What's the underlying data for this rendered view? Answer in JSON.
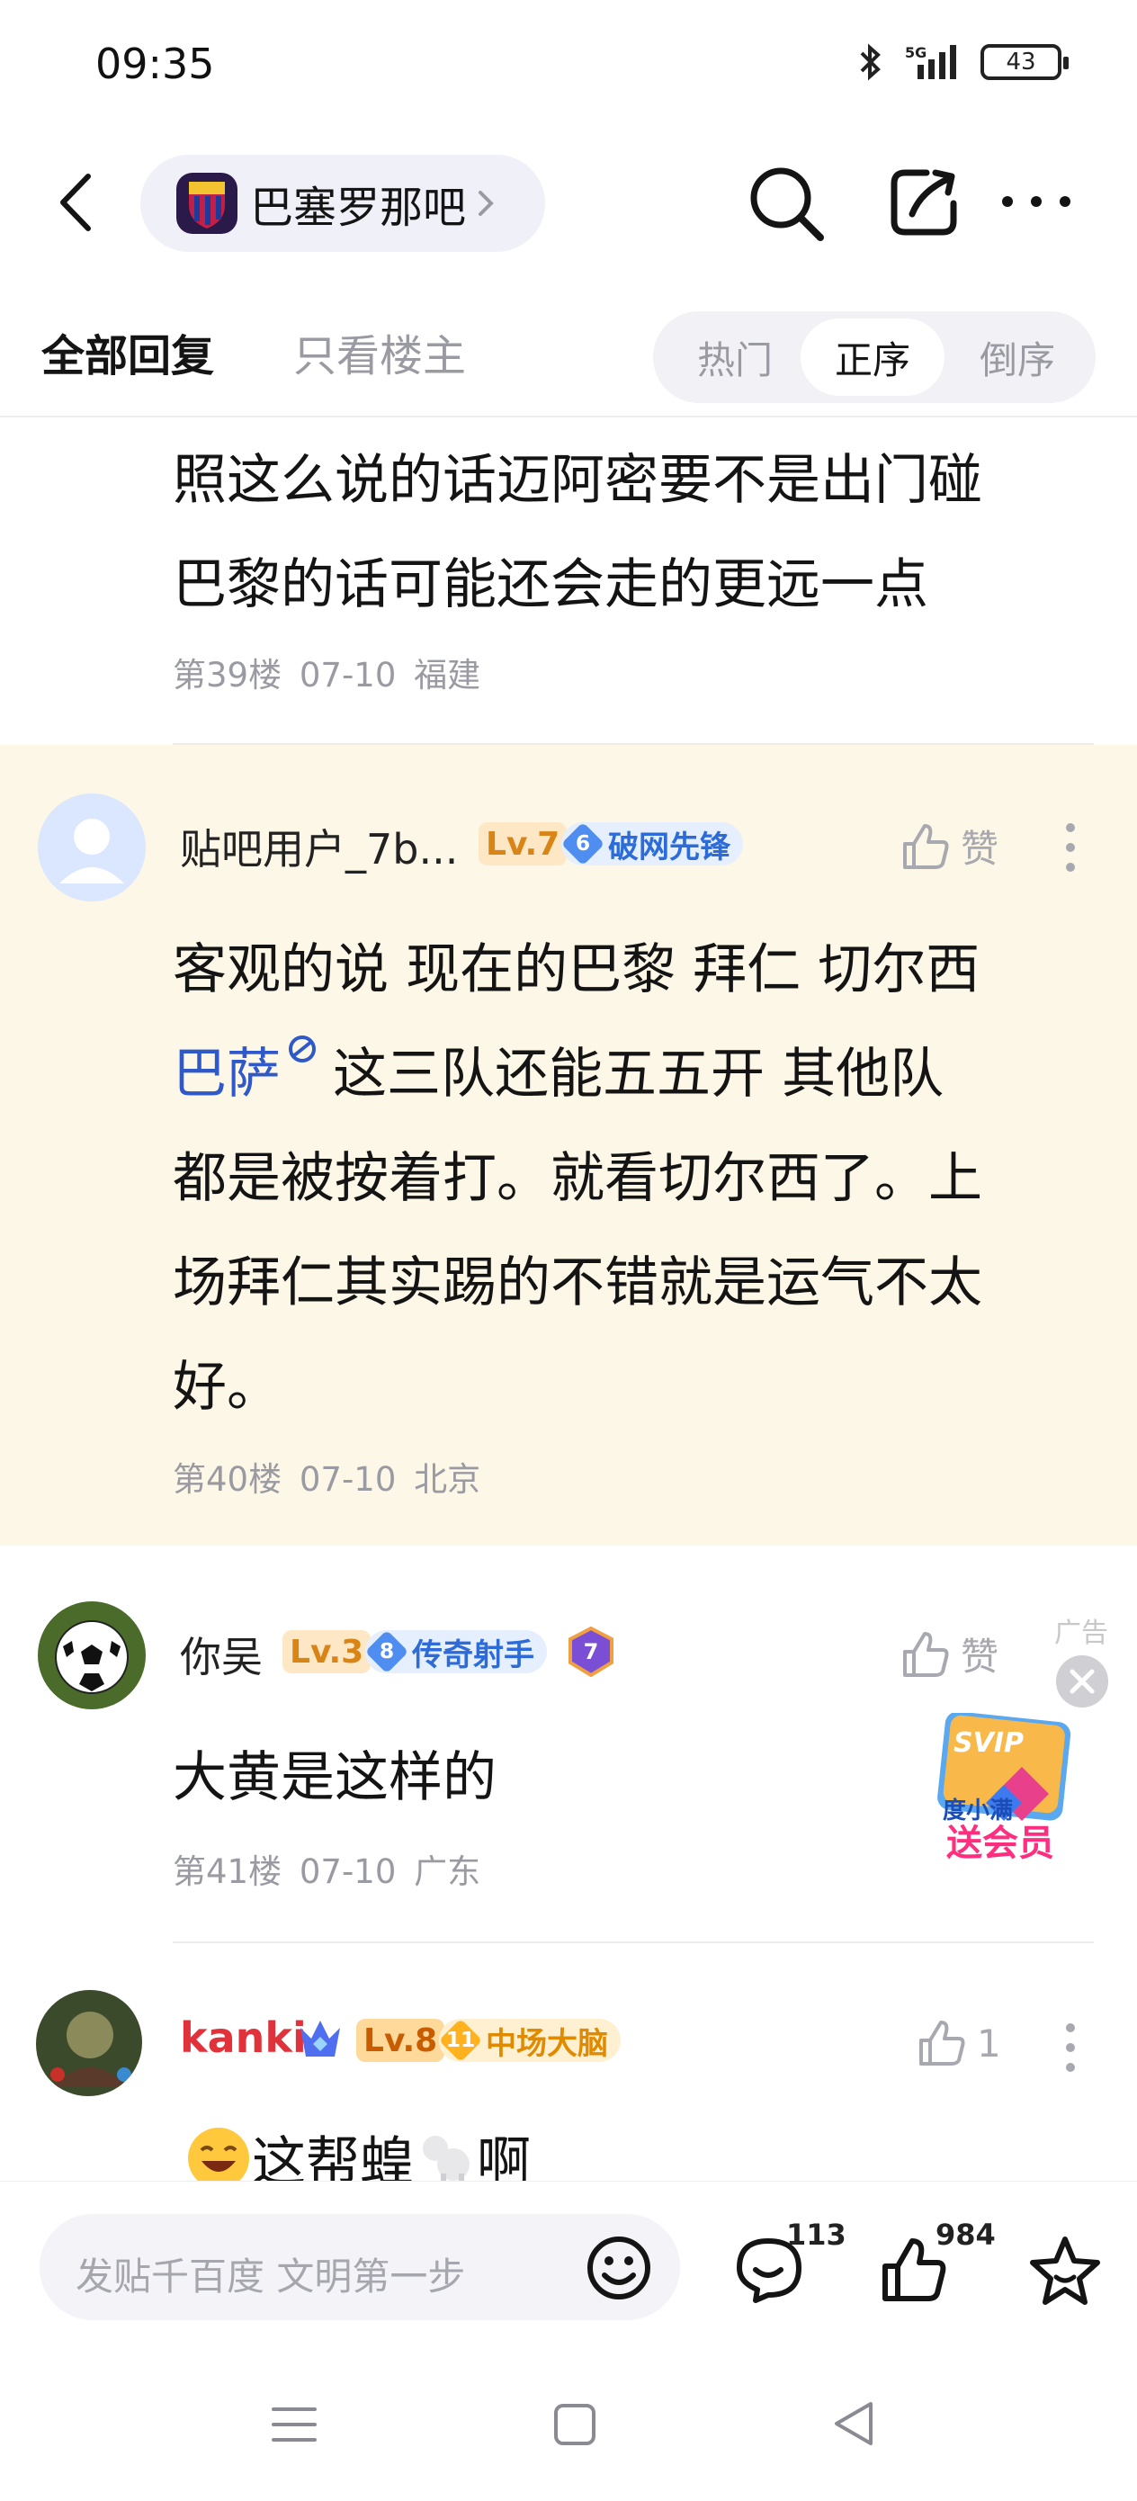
{
  "status_bar": {
    "time": "09:35",
    "network": "5G",
    "battery": "43"
  },
  "nav": {
    "forum_name": "巴塞罗那吧"
  },
  "filters": {
    "tab_all": "全部回复",
    "tab_owner": "只看楼主",
    "sort_hot": "热门",
    "sort_asc": "正序",
    "sort_desc": "倒序"
  },
  "posts": [
    {
      "text_lines": [
        "照这么说的话迈阿密要不是出门碰",
        "巴黎的话可能还会走的更远一点"
      ],
      "floor": "第39楼",
      "date": "07-10",
      "location": "福建"
    },
    {
      "username": "贴吧用户_7b...",
      "level": "Lv.7",
      "honor_num": "6",
      "honor": "破网先锋",
      "like_label": "赞",
      "line1": "客观的说 现在的巴黎 拜仁 切尔西",
      "link_text": "巴萨",
      "line2_rest": "这三队还能五五开 其他队",
      "line3": "都是被按着打。就看切尔西了。上",
      "line4": "场拜仁其实踢的不错就是运气不太",
      "line5": "好。",
      "floor": "第40楼",
      "date": "07-10",
      "location": "北京"
    },
    {
      "username": "你吴",
      "level": "Lv.3",
      "honor_num": "8",
      "honor": "传奇射手",
      "extra_badge": "7",
      "like_label": "赞",
      "text": "大黄是这样的",
      "floor": "第41楼",
      "date": "07-10",
      "location": "广东"
    },
    {
      "username": "kanki",
      "level": "Lv.8",
      "honor_num": "11",
      "honor": "中场大脑",
      "like_count": "1",
      "text_a": "这帮蝗",
      "text_b": "啊"
    }
  ],
  "ad": {
    "tag": "广告",
    "svip": "SVIP",
    "sub": "度小满",
    "label": "送会员"
  },
  "bottom_bar": {
    "placeholder": "发贴千百度 文明第一步",
    "comment_count": "113",
    "like_count": "984"
  },
  "colors": {
    "accent_blue": "#2f58c8",
    "highlight_bg": "#fcf7e6",
    "username_red": "#e0323b"
  }
}
